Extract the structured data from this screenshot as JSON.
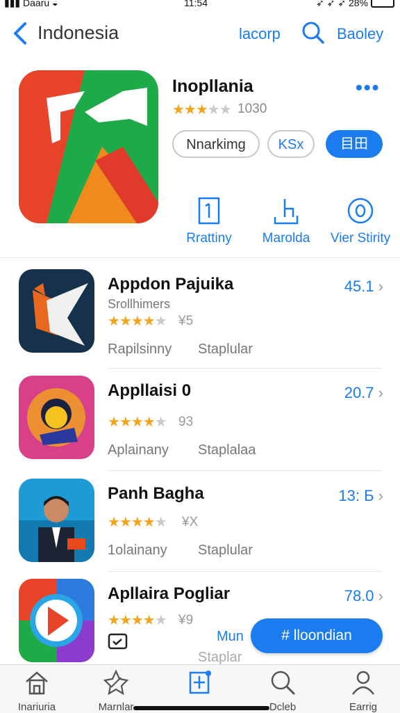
{
  "status": {
    "carrier": "Daaru",
    "time": "11:54",
    "battery": "28%"
  },
  "nav": {
    "title": "Indonesia",
    "link_left": "lacorp",
    "link_right": "Baoley"
  },
  "hero": {
    "name": "Inopllania",
    "rating_count": "1030",
    "rating": 3.5,
    "buttons": [
      "Nnarkimg",
      "KSx",
      "目田"
    ],
    "more_icon": "ellipsis-icon"
  },
  "actions": [
    {
      "label": "Rrattiny",
      "icon": "document-icon"
    },
    {
      "label": "Marolda",
      "icon": "edit-icon"
    },
    {
      "label": "Vier Stirity",
      "icon": "info-icon"
    }
  ],
  "apps": [
    {
      "name": "Appdon Pajuika",
      "subtitle": "Srollhimers",
      "rating": 4.5,
      "rating_count": "¥5",
      "price": "45.1",
      "tag1": "Rapilsinny",
      "tag2": "Staplular"
    },
    {
      "name": "Appllaisi 0",
      "subtitle": "",
      "rating": 4.0,
      "rating_count": "93",
      "price": "20.7",
      "tag1": "Aplainany",
      "tag2": "Staplalaa"
    },
    {
      "name": "Panh Bagha",
      "subtitle": "",
      "rating": 4.5,
      "rating_count": "¥X",
      "price": "13: Б",
      "tag1": "1olainany",
      "tag2": "Staplular"
    },
    {
      "name": "Apllaira Pogliar",
      "subtitle": "",
      "rating": 4.0,
      "rating_count": "¥9",
      "price": "78.0",
      "tag1": "",
      "tag2": ""
    }
  ],
  "cta": {
    "link": "Mun",
    "button": "# lloondian",
    "cut_text": "Staplar"
  },
  "tabs": [
    {
      "label": "Inariuria",
      "icon": "home-icon"
    },
    {
      "label": "Marnlar",
      "icon": "explore-icon"
    },
    {
      "label": "",
      "icon": "apps-icon"
    },
    {
      "label": "Dcleb",
      "icon": "search-icon"
    },
    {
      "label": "Earrig",
      "icon": "profile-icon"
    }
  ],
  "colors": {
    "accent": "#1b7cf0",
    "star": "#f2a41c"
  }
}
